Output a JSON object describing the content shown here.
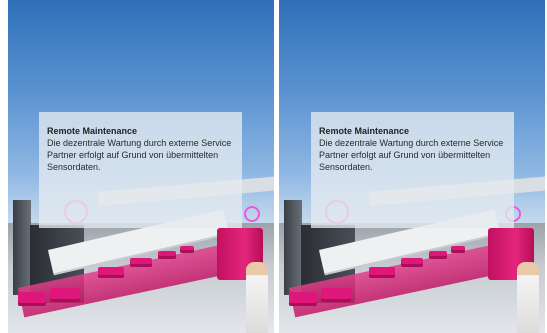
{
  "views": [
    {
      "id": "left-eye",
      "panel": {
        "title": "Remote Maintenance",
        "body": "Die dezentrale Wartung durch externe Service Partner erfolgt auf Grund von übermittelten Sensordaten."
      }
    },
    {
      "id": "right-eye",
      "panel": {
        "title": "Remote Maintenance",
        "body": "Die dezentrale Wartung durch externe Service Partner erfolgt auf Grund von übermittelten Sensordaten."
      }
    }
  ],
  "colors": {
    "brand_magenta": "#e0177a",
    "ring_highlight": "#e85bd6",
    "sky_top": "#2f6fb8",
    "panel_bg": "#e6eaf0"
  }
}
